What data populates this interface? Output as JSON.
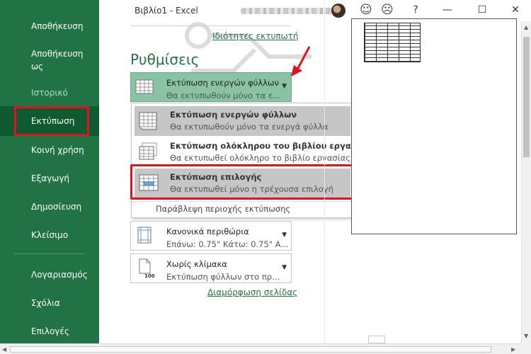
{
  "app": {
    "title": "Βιβλίο1  -  Excel"
  },
  "titlebar": {
    "help": "?",
    "minimize": "—",
    "maximize": "☐",
    "close": "✕"
  },
  "sidebar": {
    "items": [
      {
        "label": "Αποθήκευση",
        "state": "normal"
      },
      {
        "label": "Αποθήκευση",
        "label2": "ως",
        "state": "normal"
      },
      {
        "label": "Ιστορικό",
        "state": "disabled"
      },
      {
        "label": "Εκτύπωση",
        "state": "selected"
      },
      {
        "label": "Κοινή χρήση",
        "state": "normal"
      },
      {
        "label": "Εξαγωγή",
        "state": "normal"
      },
      {
        "label": "Δημοσίευση",
        "state": "normal"
      },
      {
        "label": "Κλείσιμο",
        "state": "normal"
      },
      {
        "label": "Λογαριασμός",
        "state": "normal"
      },
      {
        "label": "Σχόλια",
        "state": "normal"
      },
      {
        "label": "Επιλογές",
        "state": "normal"
      }
    ]
  },
  "printer": {
    "properties_link": "Ιδιότητες εκτυπωτή"
  },
  "settings": {
    "heading": "Ρυθμίσεις",
    "what_to_print": {
      "title": "Εκτύπωση ενεργών φύλλων",
      "subtitle": "Θα εκτυπωθούν μόνο τα ε..."
    },
    "menu": {
      "items": [
        {
          "title": "Εκτύπωση ενεργών φύλλων",
          "subtitle": "Θα εκτυπωθούν μόνο τα ενεργά φύλλα",
          "state": "selected"
        },
        {
          "title": "Εκτύπωση ολόκληρου του βιβλίου εργασίας",
          "subtitle": "Θα εκτυπωθεί ολόκληρο το βιβλίο εργασίας",
          "state": "normal"
        },
        {
          "title": "Εκτύπωση επιλογής",
          "subtitle": "Θα εκτυπωθεί μόνο η τρέχουσα επιλογή",
          "state": "hover"
        }
      ],
      "footer": "Παράβλεψη περιοχής εκτύπωσης"
    },
    "margins": {
      "title": "Κανονικά περιθώρια",
      "subtitle": "Επάνω: 0.75\" Κάτω: 0.75\" Α..."
    },
    "scaling": {
      "title": "Χωρίς κλίμακα",
      "subtitle": "Εκτύπωση φύλλων στο πρ...",
      "icon_label": "100"
    },
    "page_setup_link": "Διαμόρφωση σελίδας"
  },
  "colors": {
    "accent": "#217346",
    "highlight": "#e0141e",
    "active_dropdown": "#88c4a2"
  }
}
